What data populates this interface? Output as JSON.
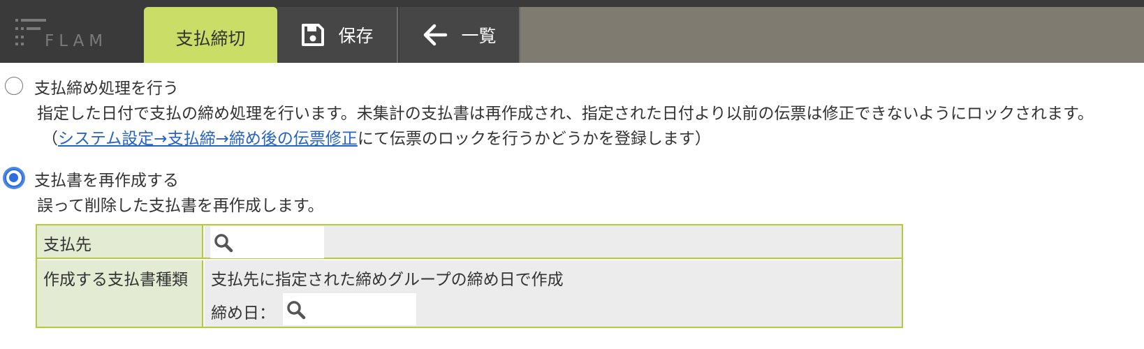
{
  "app": {
    "logo_text": "FLAM"
  },
  "toolbar": {
    "active_tab_label": "支払締切",
    "save_label": "保存",
    "list_label": "一覧"
  },
  "options": {
    "closing": {
      "label": "支払締め処理を行う",
      "description": "指定した日付で支払の締め処理を行います。未集計の支払書は再作成され、指定された日付より以前の伝票は修正できないようにロックされます。",
      "note_prefix": "（",
      "note_link": "システム設定→支払締→締め後の伝票修正",
      "note_suffix": "にて伝票のロックを行うかどうかを登録します）",
      "selected": false
    },
    "recreate": {
      "label": "支払書を再作成する",
      "description": "誤って削除した支払書を再作成します。",
      "selected": true
    }
  },
  "form": {
    "payee_label": "支払先",
    "payee_value": "",
    "type_label": "作成する支払書種類",
    "type_text": "支払先に指定された締めグループの締め日で作成",
    "closing_date_label": "締め日：",
    "closing_date_value": ""
  },
  "colors": {
    "accent_tab": "#cadd66",
    "table_border": "#b2cb3b",
    "radio_selected": "#2a6fdb",
    "link": "#2563c6"
  },
  "icons": {
    "save": "floppy-disk-icon",
    "list": "arrow-left-icon",
    "search": "magnifier-icon"
  }
}
